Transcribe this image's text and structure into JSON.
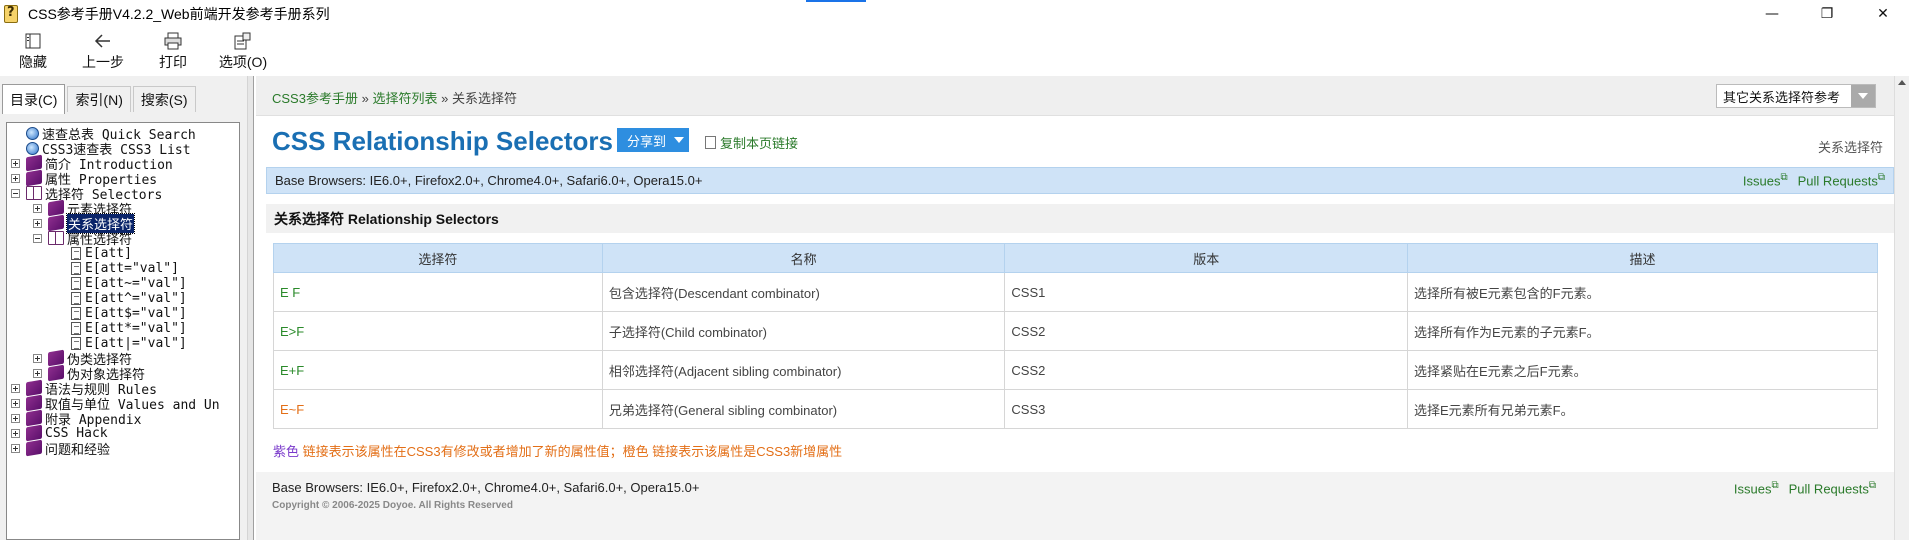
{
  "window": {
    "title": "CSS参考手册V4.2.2_Web前端开发参考手册系列",
    "app_icon": "help-file-icon",
    "minimize": "—",
    "maximize": "❐",
    "close": "✕"
  },
  "toolbar": {
    "hide": "隐藏",
    "back": "上一步",
    "print": "打印",
    "options": "选项(O)"
  },
  "tabs": [
    "目录(C)",
    "索引(N)",
    "搜索(S)"
  ],
  "tree": [
    {
      "label": "速查总表 Quick Search",
      "icon": "globe-icon"
    },
    {
      "label": "CSS3速查表 CSS3 List",
      "icon": "globe-icon"
    },
    {
      "label": "简介 Introduction",
      "icon": "book-icon"
    },
    {
      "label": "属性 Properties",
      "icon": "book-icon"
    },
    {
      "label": "选择符 Selectors",
      "icon": "open-book-icon"
    },
    {
      "label": "元素选择符",
      "icon": "book-icon"
    },
    {
      "label": "关系选择符",
      "icon": "book-icon"
    },
    {
      "label": "属性选择符",
      "icon": "open-book-icon"
    },
    {
      "label": "E[att]",
      "icon": "page-icon"
    },
    {
      "label": "E[att=\"val\"]",
      "icon": "page-icon"
    },
    {
      "label": "E[att~=\"val\"]",
      "icon": "page-icon"
    },
    {
      "label": "E[att^=\"val\"]",
      "icon": "page-icon"
    },
    {
      "label": "E[att$=\"val\"]",
      "icon": "page-icon"
    },
    {
      "label": "E[att*=\"val\"]",
      "icon": "page-icon"
    },
    {
      "label": "E[att|=\"val\"]",
      "icon": "page-icon"
    },
    {
      "label": "伪类选择符",
      "icon": "book-icon"
    },
    {
      "label": "伪对象选择符",
      "icon": "book-icon"
    },
    {
      "label": "语法与规则 Rules",
      "icon": "book-icon"
    },
    {
      "label": "取值与单位 Values and Un",
      "icon": "book-icon"
    },
    {
      "label": "附录 Appendix",
      "icon": "book-icon"
    },
    {
      "label": "CSS Hack",
      "icon": "book-icon"
    },
    {
      "label": "问题和经验",
      "icon": "book-icon"
    }
  ],
  "breadcrumb": {
    "home": "CSS3参考手册",
    "sep": "»",
    "list": "选择符列表",
    "current": "关系选择符"
  },
  "other_select": "其它关系选择符参考",
  "page": {
    "title": "CSS Relationship Selectors",
    "share": "分享到",
    "copy_link": "复制本页链接",
    "right_label": "关系选择符",
    "browsers": "Base Browsers: IE6.0+, Firefox2.0+, Chrome4.0+, Safari6.0+, Opera15.0+",
    "issues": "Issues",
    "pull_requests": "Pull Requests",
    "section_title": "关系选择符 Relationship Selectors"
  },
  "table": {
    "headers": [
      "选择符",
      "名称",
      "版本",
      "描述"
    ],
    "rows": [
      [
        "E F",
        "包含选择符(Descendant combinator)",
        "CSS1",
        "选择所有被E元素包含的F元素。"
      ],
      [
        "E>F",
        "子选择符(Child combinator)",
        "CSS2",
        "选择所有作为E元素的子元素F。"
      ],
      [
        "E+F",
        "相邻选择符(Adjacent sibling combinator)",
        "CSS2",
        "选择紧贴在E元素之后F元素。"
      ],
      [
        "E~F",
        "兄弟选择符(General sibling combinator)",
        "CSS3",
        "选择E元素所有兄弟元素F。"
      ]
    ]
  },
  "legend": {
    "purple": "紫色",
    "purple_text": " 链接表示该属性在CSS3有修改或者增加了新的属性值；",
    "orange": "橙色",
    "orange_text": " 链接表示该属性是CSS3新增属性"
  },
  "footer": {
    "browsers": "Base Browsers: IE6.0+, Firefox2.0+, Chrome4.0+, Safari6.0+, Opera15.0+",
    "issues": "Issues",
    "pull_requests": "Pull Requests",
    "copyright": "Copyright © 2006-2025 Doyoe. All Rights Reserved"
  },
  "colors": {
    "link_green": "#2a7a2a",
    "title_blue": "#1a6fb3",
    "header_blue": "#cfe3f7",
    "share_blue": "#2e8ee0",
    "orange": "#e36f17",
    "purple": "#7a3acb",
    "tree_selected": "#0a246a"
  }
}
